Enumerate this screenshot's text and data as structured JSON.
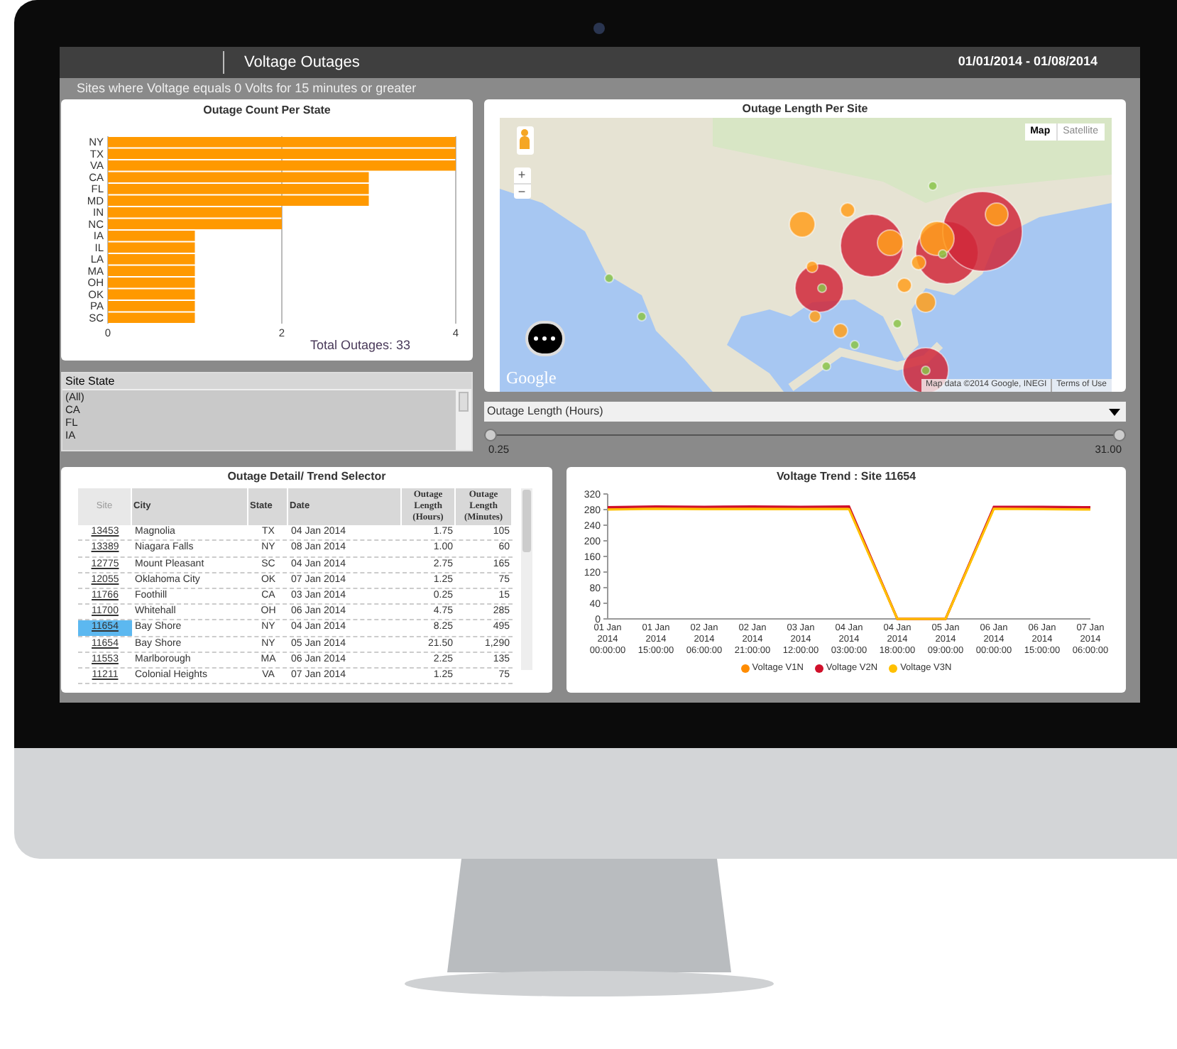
{
  "header": {
    "title": "Voltage Outages",
    "date_range": "01/01/2014 - 01/08/2014",
    "subtitle": "Sites where Voltage equals 0 Volts for 15 minutes or greater"
  },
  "outage_count": {
    "title": "Outage Count Per State",
    "total": "Total Outages: 33",
    "chart_data": {
      "type": "bar",
      "orientation": "horizontal",
      "categories": [
        "NY",
        "TX",
        "VA",
        "CA",
        "FL",
        "MD",
        "IN",
        "NC",
        "IA",
        "IL",
        "LA",
        "MA",
        "OH",
        "OK",
        "PA",
        "SC"
      ],
      "values": [
        4,
        4,
        4,
        3,
        3,
        3,
        2,
        2,
        1,
        1,
        1,
        1,
        1,
        1,
        1,
        1
      ],
      "xlim": [
        0,
        4
      ],
      "xticks": [
        0,
        2,
        4
      ]
    }
  },
  "site_state": {
    "label": "Site State",
    "items": [
      "(All)",
      "CA",
      "FL",
      "IA"
    ]
  },
  "map": {
    "title": "Outage Length Per Site",
    "map_types": [
      {
        "label": "Map",
        "selected": true
      },
      {
        "label": "Satellite",
        "selected": false
      }
    ],
    "zoom_in": "+",
    "zoom_out": "−",
    "logo": "Google",
    "attribution": "Map data ©2014 Google, INEGI",
    "terms": "Terms of Use"
  },
  "filter": {
    "dropdown": "Outage Length (Hours)",
    "range_min": "0.25",
    "range_max": "31.00",
    "low": {
      "level": 0
    },
    "high": {
      "level": 1
    }
  },
  "table": {
    "title": "Outage Detail/ Trend Selector",
    "columns": [
      "Site",
      "City",
      "State",
      "Date",
      "Outage Length (Hours)",
      "Outage Length (Minutes)"
    ],
    "rows": [
      {
        "cells": [
          "13453",
          "Magnolia",
          "TX",
          "04 Jan 2014",
          "1.75",
          "105"
        ],
        "selected": false
      },
      {
        "cells": [
          "13389",
          "Niagara Falls",
          "NY",
          "08 Jan 2014",
          "1.00",
          "60"
        ],
        "selected": false
      },
      {
        "cells": [
          "12775",
          "Mount Pleasant",
          "SC",
          "04 Jan 2014",
          "2.75",
          "165"
        ],
        "selected": false
      },
      {
        "cells": [
          "12055",
          "Oklahoma City",
          "OK",
          "07 Jan 2014",
          "1.25",
          "75"
        ],
        "selected": false
      },
      {
        "cells": [
          "11766",
          "Foothill",
          "CA",
          "03 Jan 2014",
          "0.25",
          "15"
        ],
        "selected": false
      },
      {
        "cells": [
          "11700",
          "Whitehall",
          "OH",
          "06 Jan 2014",
          "4.75",
          "285"
        ],
        "selected": false
      },
      {
        "cells": [
          "11654",
          "Bay Shore",
          "NY",
          "04 Jan 2014",
          "8.25",
          "495"
        ],
        "selected": true
      },
      {
        "cells": [
          "11654",
          "Bay Shore",
          "NY",
          "05 Jan 2014",
          "21.50",
          "1,290"
        ],
        "selected": false
      },
      {
        "cells": [
          "11553",
          "Marlborough",
          "MA",
          "06 Jan 2014",
          "2.25",
          "135"
        ],
        "selected": false
      },
      {
        "cells": [
          "11211",
          "Colonial Heights",
          "VA",
          "07 Jan 2014",
          "1.25",
          "75"
        ],
        "selected": false
      }
    ]
  },
  "trend": {
    "title": "Voltage Trend : Site 11654",
    "chart_data": {
      "type": "line",
      "categories": [
        "01 Jan 2014 00:00:00",
        "01 Jan 2014 15:00:00",
        "02 Jan 2014 06:00:00",
        "02 Jan 2014 21:00:00",
        "03 Jan 2014 12:00:00",
        "04 Jan 2014 03:00:00",
        "04 Jan 2014 18:00:00",
        "05 Jan 2014 09:00:00",
        "06 Jan 2014 00:00:00",
        "06 Jan 2014 15:00:00",
        "07 Jan 2014 06:00:00"
      ],
      "ylim": [
        0,
        320
      ],
      "yticks": [
        0,
        40,
        80,
        120,
        160,
        200,
        240,
        280,
        320
      ],
      "series": [
        {
          "name": "Voltage V1N",
          "color": "#ff8c00",
          "values": [
            283,
            285,
            284,
            285,
            284,
            284,
            0,
            0,
            284,
            284,
            283
          ]
        },
        {
          "name": "Voltage V2N",
          "color": "#d0102a",
          "values": [
            286,
            288,
            287,
            288,
            287,
            288,
            0,
            0,
            287,
            287,
            286
          ]
        },
        {
          "name": "Voltage V3N",
          "color": "#ffc000",
          "values": [
            280,
            282,
            281,
            281,
            281,
            281,
            0,
            0,
            282,
            281,
            280
          ]
        }
      ]
    }
  }
}
